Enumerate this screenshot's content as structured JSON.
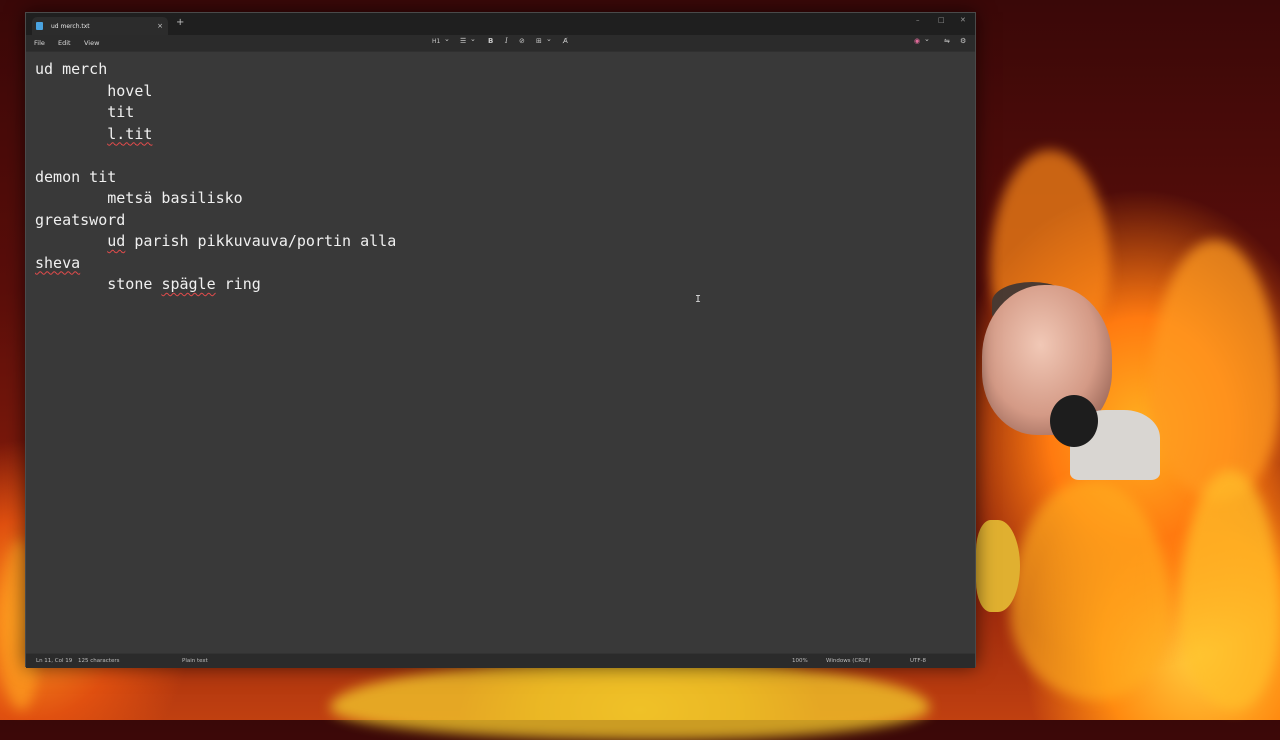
{
  "tab": {
    "title": "ud merch.txt",
    "close_glyph": "×",
    "new_tab_glyph": "+"
  },
  "window_controls": {
    "minimize": "–",
    "maximize": "□",
    "close": "✕"
  },
  "menu": {
    "file": "File",
    "edit": "Edit",
    "view": "View"
  },
  "toolbar": {
    "heading": "H1",
    "heading_chevron": "⌄",
    "list": "☰",
    "list_chevron": "⌄",
    "bold": "B",
    "italic": "I",
    "link": "⊘",
    "table": "⊞",
    "table_chevron": "⌄",
    "clear_format": "A̸",
    "copilot": "◉",
    "copilot_chevron": "⌄",
    "markdown_toggle": "⇋",
    "settings": "⚙"
  },
  "document": {
    "lines": [
      {
        "indent": false,
        "segments": [
          {
            "t": "ud merch",
            "sq": false
          }
        ]
      },
      {
        "indent": true,
        "segments": [
          {
            "t": "hovel",
            "sq": false
          }
        ]
      },
      {
        "indent": true,
        "segments": [
          {
            "t": "tit",
            "sq": false
          }
        ]
      },
      {
        "indent": true,
        "segments": [
          {
            "t": "l.tit",
            "sq": true
          }
        ]
      },
      {
        "indent": false,
        "segments": [
          {
            "t": "",
            "sq": false
          }
        ]
      },
      {
        "indent": false,
        "segments": [
          {
            "t": "demon tit",
            "sq": false
          }
        ]
      },
      {
        "indent": true,
        "segments": [
          {
            "t": "metsä basilisko",
            "sq": false
          }
        ]
      },
      {
        "indent": false,
        "segments": [
          {
            "t": "greatsword",
            "sq": false
          }
        ]
      },
      {
        "indent": true,
        "segments": [
          {
            "t": "ud",
            "sq": true
          },
          {
            "t": " parish pikkuvauva/portin alla",
            "sq": false
          }
        ]
      },
      {
        "indent": false,
        "segments": [
          {
            "t": "sheva",
            "sq": true
          }
        ]
      },
      {
        "indent": true,
        "segments": [
          {
            "t": "stone ",
            "sq": false
          },
          {
            "t": "spägle",
            "sq": true
          },
          {
            "t": " ring",
            "sq": false
          }
        ]
      }
    ]
  },
  "cursor_glyph": "I",
  "statusbar": {
    "position": "Ln 11, Col 19",
    "characters": "125 characters",
    "format": "Plain text",
    "zoom": "100%",
    "line_ending": "Windows (CRLF)",
    "encoding": "UTF-8"
  },
  "icons": {
    "tab_doc": "notepad-doc-icon",
    "cursor": "text-cursor-icon"
  },
  "colors": {
    "window_bg": "#393939",
    "titlebar_bg": "#1f1f1f",
    "text": "#f0f0f0",
    "spellcheck": "#e24b4b",
    "tab_icon": "#4aa3e0"
  }
}
